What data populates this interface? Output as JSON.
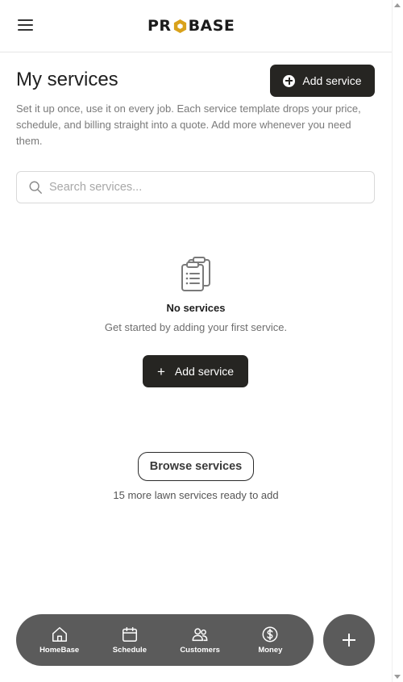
{
  "header": {
    "logo_left": "PR",
    "logo_right": "BASE",
    "brand_color": "#d9a21b"
  },
  "page": {
    "title": "My services",
    "add_button_label": "Add service",
    "description": "Set it up once, use it on every job. Each service template drops your price, schedule, and billing straight into a quote. Add more whenever you need them."
  },
  "search": {
    "placeholder": "Search services...",
    "value": ""
  },
  "empty_state": {
    "icon": "clipboard-list-icon",
    "title": "No services",
    "subtitle": "Get started by adding your first service.",
    "button_label": "Add service"
  },
  "browse": {
    "button_label": "Browse services",
    "caption": "15 more lawn services ready to add"
  },
  "bottom_nav": {
    "items": [
      {
        "label": "HomeBase",
        "icon": "home-icon"
      },
      {
        "label": "Schedule",
        "icon": "calendar-icon"
      },
      {
        "label": "Customers",
        "icon": "users-icon"
      },
      {
        "label": "Money",
        "icon": "dollar-icon"
      }
    ],
    "fab_icon": "plus-icon"
  }
}
